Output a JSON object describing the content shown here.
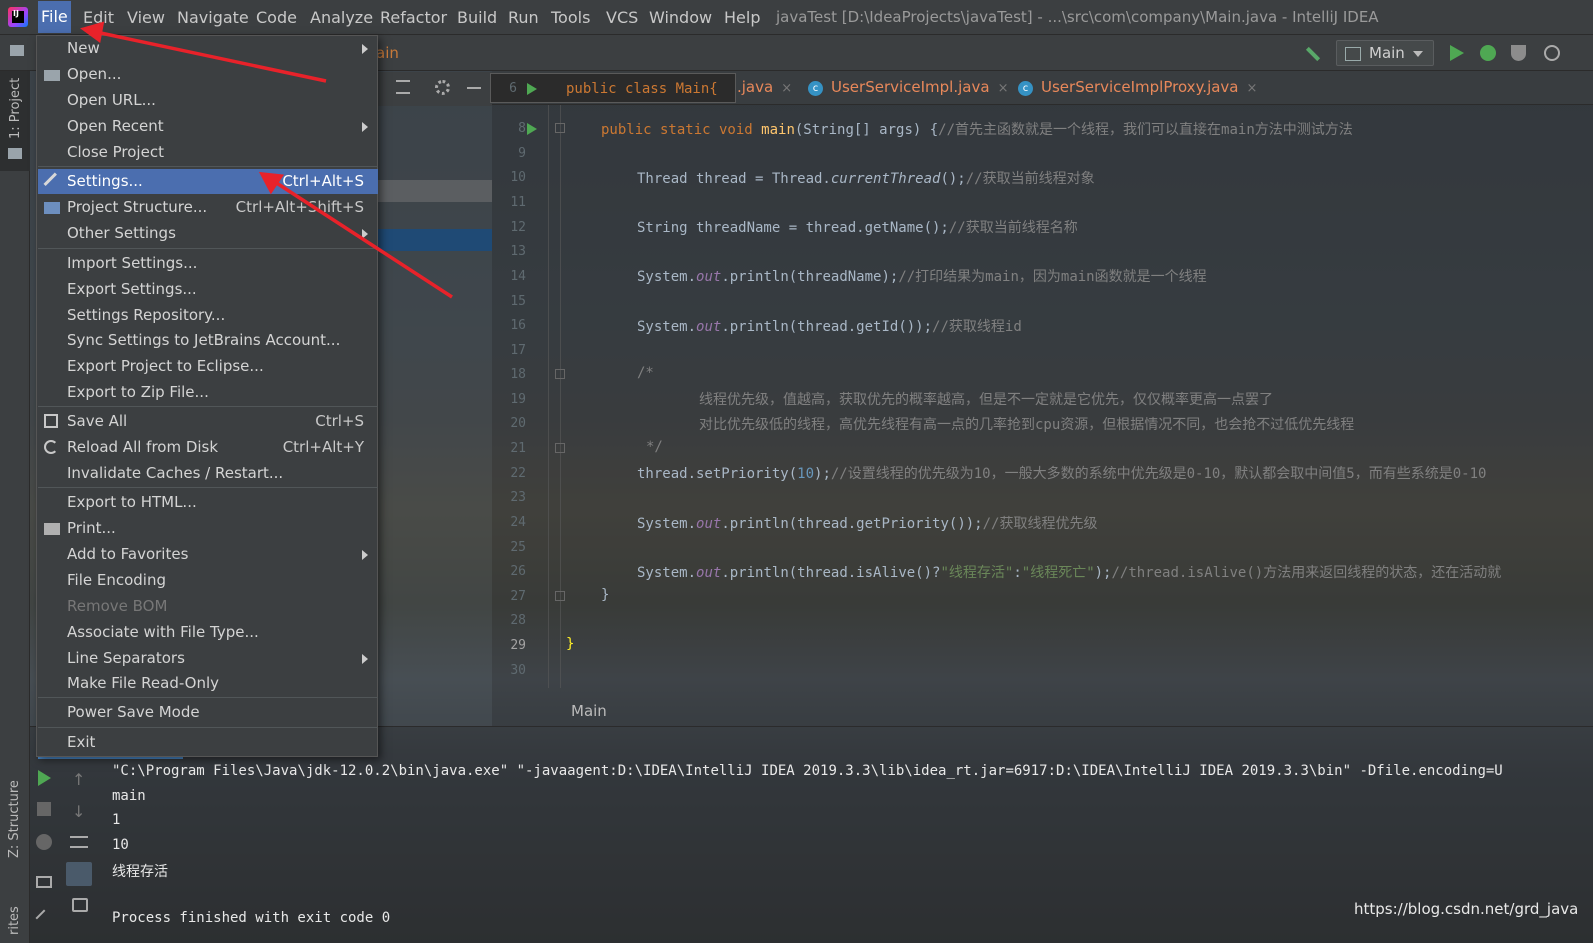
{
  "menubar": {
    "items": [
      "File",
      "Edit",
      "View",
      "Navigate",
      "Code",
      "Analyze",
      "Refactor",
      "Build",
      "Run",
      "Tools",
      "VCS",
      "Window",
      "Help"
    ],
    "window_title": "javaTest [D:\\IdeaProjects\\javaTest] - ...\\src\\com\\company\\Main.java - IntelliJ IDEA"
  },
  "navbar": {
    "crumb": "ain",
    "run_config": "Main"
  },
  "tool_windows": {
    "project": "1: Project",
    "structure": "Z: Structure",
    "favorites": "rites"
  },
  "editor": {
    "tabs": [
      {
        "label": ".java"
      },
      {
        "label": "UserServiceImpl.java"
      },
      {
        "label": "UserServiceImplProxy.java"
      }
    ],
    "tab_close": "×",
    "class_icon": "c",
    "sticky": {
      "line": "6",
      "text": "public class Main{"
    },
    "line_numbers": [
      "8",
      "9",
      "10",
      "11",
      "12",
      "13",
      "14",
      "15",
      "16",
      "17",
      "18",
      "19",
      "20",
      "21",
      "22",
      "23",
      "24",
      "25",
      "26",
      "27",
      "28",
      "29",
      "30"
    ],
    "lines": {
      "l8a": "public static void ",
      "l8b": "main",
      "l8c": "(String[] args) {",
      "l8d": "//首先主函数就是一个线程，我们可以直接在main方法中测试方法",
      "l10a": "Thread thread = Thread.",
      "l10b": "currentThread",
      "l10c": "();",
      "l10d": "//获取当前线程对象",
      "l12a": "String threadName = thread.getName();",
      "l12b": "//获取当前线程名称",
      "l14a": "System.",
      "l14b": "out",
      "l14c": ".println(threadName);",
      "l14d": "//打印结果为main，因为main函数就是一个线程",
      "l16a": "System.",
      "l16b": "out",
      "l16c": ".println(thread.getId());",
      "l16d": "//获取线程id",
      "l18": "/*",
      "l19": "线程优先级，值越高，获取优先的概率越高，但是不一定就是它优先，仅仅概率更高一点罢了",
      "l20": "对比优先级低的线程，高优先线程有高一点的几率抢到cpu资源，但根据情况不同，也会抢不过低优先线程",
      "l21": "*/",
      "l22a": "thread.setPriority(",
      "l22b": "10",
      "l22c": ");",
      "l22d": "//设置线程的优先级为10，一般大多数的系统中优先级是0-10，默认都会取中间值5，而有些系统是0-10",
      "l24a": "System.",
      "l24b": "out",
      "l24c": ".println(thread.getPriority());",
      "l24d": "//获取线程优先级",
      "l26a": "System.",
      "l26b": "out",
      "l26c": ".println(thread.isAlive()?",
      "l26d": "\"线程存活\"",
      "l26e": ":",
      "l26f": "\"线程死亡\"",
      "l26g": ");",
      "l26h": "//thread.isAlive()方法用来返回线程的状态，还在活动就",
      "l27": "}",
      "l29": "}"
    },
    "breadcrumb": "Main"
  },
  "console": {
    "lines": [
      "\"C:\\Program Files\\Java\\jdk-12.0.2\\bin\\java.exe\" \"-javaagent:D:\\IDEA\\IntelliJ IDEA 2019.3.3\\lib\\idea_rt.jar=6917:D:\\IDEA\\IntelliJ IDEA 2019.3.3\\bin\" -Dfile.encoding=U",
      "main",
      "1",
      "10",
      "线程存活",
      "",
      "Process finished with exit code 0"
    ]
  },
  "file_menu": {
    "items": [
      {
        "label": "New",
        "shortcut": "",
        "submenu": true
      },
      {
        "label": "Open...",
        "shortcut": "",
        "icon": "folder-open-icon"
      },
      {
        "label": "Open URL...",
        "shortcut": ""
      },
      {
        "label": "Open Recent",
        "shortcut": "",
        "submenu": true
      },
      {
        "label": "Close Project",
        "shortcut": ""
      },
      {
        "label": "Settings...",
        "shortcut": "Ctrl+Alt+S",
        "icon": "wrench-icon",
        "selected": true
      },
      {
        "label": "Project Structure...",
        "shortcut": "Ctrl+Alt+Shift+S",
        "icon": "project-structure-icon"
      },
      {
        "label": "Other Settings",
        "shortcut": "",
        "submenu": true
      },
      {
        "label": "Import Settings...",
        "shortcut": ""
      },
      {
        "label": "Export Settings...",
        "shortcut": ""
      },
      {
        "label": "Settings Repository...",
        "shortcut": ""
      },
      {
        "label": "Sync Settings to JetBrains Account...",
        "shortcut": ""
      },
      {
        "label": "Export Project to Eclipse...",
        "shortcut": ""
      },
      {
        "label": "Export to Zip File...",
        "shortcut": ""
      },
      {
        "label": "Save All",
        "shortcut": "Ctrl+S",
        "icon": "save-icon"
      },
      {
        "label": "Reload All from Disk",
        "shortcut": "Ctrl+Alt+Y",
        "icon": "reload-icon"
      },
      {
        "label": "Invalidate Caches / Restart...",
        "shortcut": ""
      },
      {
        "label": "Export to HTML...",
        "shortcut": ""
      },
      {
        "label": "Print...",
        "shortcut": "",
        "icon": "print-icon"
      },
      {
        "label": "Add to Favorites",
        "shortcut": "",
        "submenu": true
      },
      {
        "label": "File Encoding",
        "shortcut": ""
      },
      {
        "label": "Remove BOM",
        "shortcut": "",
        "disabled": true
      },
      {
        "label": "Associate with File Type...",
        "shortcut": ""
      },
      {
        "label": "Line Separators",
        "shortcut": "",
        "submenu": true
      },
      {
        "label": "Make File Read-Only",
        "shortcut": ""
      },
      {
        "label": "Power Save Mode",
        "shortcut": ""
      },
      {
        "label": "Exit",
        "shortcut": ""
      }
    ]
  },
  "watermark": "https://blog.csdn.net/grd_java",
  "colors": {
    "accent": "#4b6eaf",
    "annotation_arrow": "#e8222a",
    "run_green": "#4fa853"
  }
}
